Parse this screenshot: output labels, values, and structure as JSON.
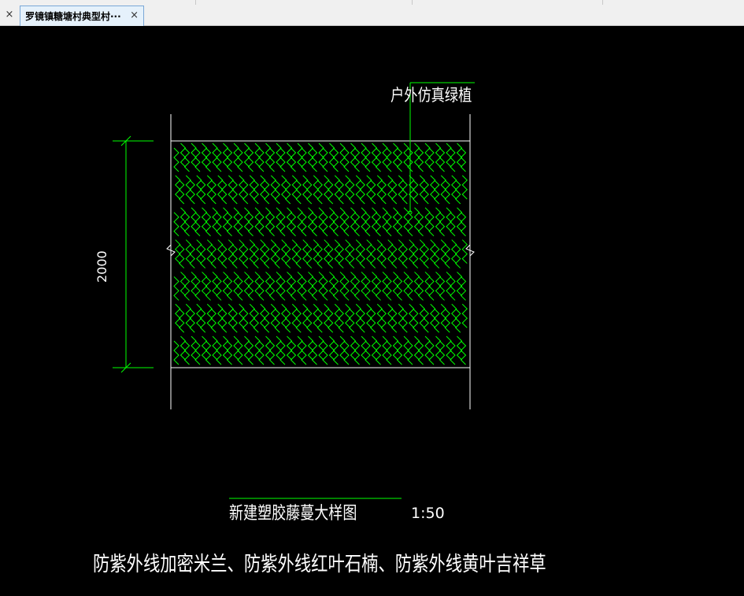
{
  "tabs": {
    "close_left": "×",
    "active_title": "罗镜镇糖塘村典型村···",
    "active_close": "×"
  },
  "drawing": {
    "plant_label": "户外仿真绿植",
    "dimension": "2000",
    "title": "新建塑胶藤蔓大样图",
    "scale": "1:50",
    "note": "防紫外线加密米兰、防紫外线红叶石楠、防紫外线黄叶吉祥草"
  },
  "colors": {
    "background": "#000000",
    "line_white": "#ffffff",
    "line_green": "#00ff00",
    "tab_active_bg": "#e5f1fb",
    "tab_border": "#7aa7d6"
  }
}
